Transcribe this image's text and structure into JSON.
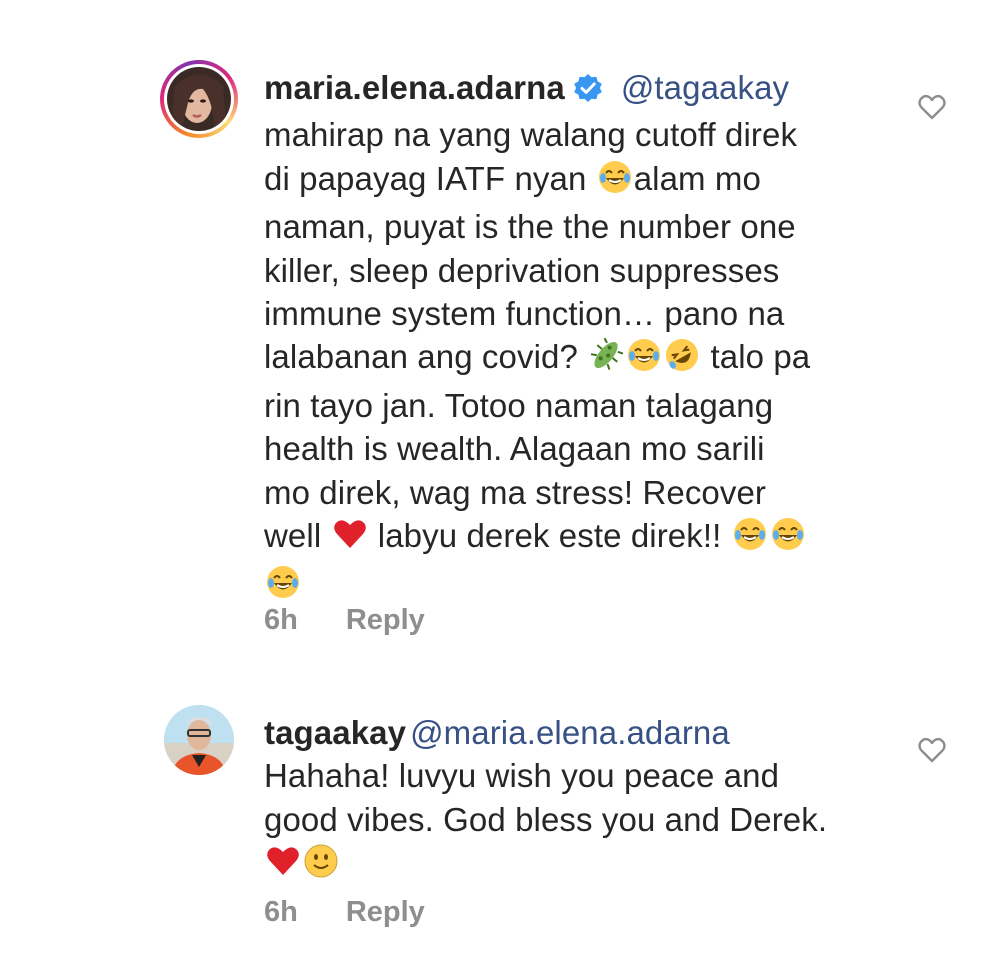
{
  "comments": [
    {
      "username": "maria.elena.adarna",
      "verified": true,
      "mention": "@tagaakay",
      "lines": [
        "mahirap na yang walang cutoff direk",
        "di papayag IATF nyan ",
        "alam mo",
        "naman, puyat is the the number one",
        "killer, sleep deprivation suppresses",
        "immune system function… pano na",
        "lalabanan ang covid? ",
        " talo pa",
        "rin tayo jan. Totoo naman talagang",
        "health is wealth. Alagaan mo sarili",
        "mo direk, wag ma stress! Recover",
        "well ",
        " labyu derek este direk!! "
      ],
      "time": "6h",
      "reply_label": "Reply"
    },
    {
      "username": "tagaakay",
      "verified": false,
      "mention": "@maria.elena.adarna",
      "lines": [
        "Hahaha! luvyu wish you peace and",
        "good vibes. God bless you and Derek."
      ],
      "time": "6h",
      "reply_label": "Reply"
    }
  ],
  "icons": {
    "like": "heart-outline-icon",
    "verified": "verified-badge-icon",
    "emoji_joy": "face-with-tears-of-joy-icon",
    "emoji_rofl": "rolling-on-floor-laughing-icon",
    "emoji_microbe": "microbe-icon",
    "emoji_heart": "red-heart-icon",
    "emoji_smile": "slightly-smiling-face-icon"
  },
  "colors": {
    "text": "#262626",
    "mention": "#385185",
    "meta": "#8e8e8e",
    "verified": "#3897f0",
    "heart": "#e0202b"
  }
}
